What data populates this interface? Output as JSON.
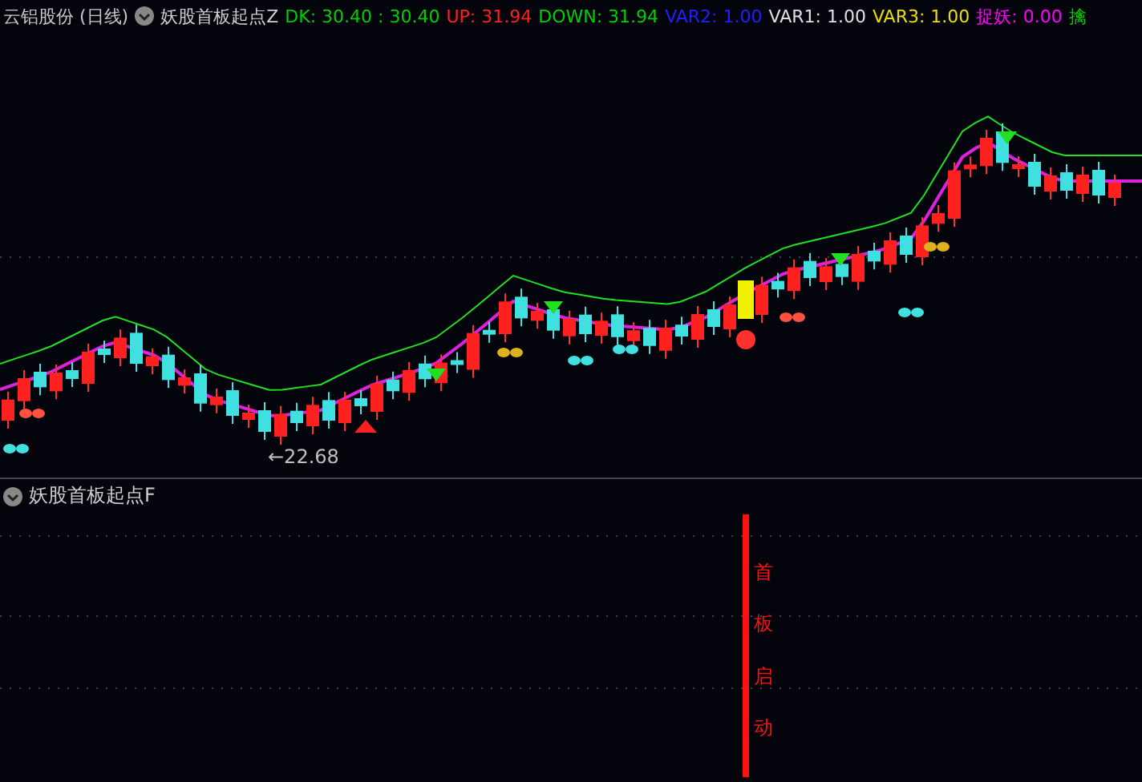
{
  "header": {
    "title": "云铝股份 (日线)",
    "indicator": "妖股首板起点Z",
    "values": [
      {
        "label": "DK:",
        "value": "30.40 : 30.40",
        "color": "#00d000"
      },
      {
        "label": "UP:",
        "value": "31.94",
        "color": "#ff2020"
      },
      {
        "label": "DOWN:",
        "value": "31.94",
        "color": "#00d000"
      },
      {
        "label": "VAR2:",
        "value": "1.00",
        "color": "#2020ff"
      },
      {
        "label": "VAR1:",
        "value": "1.00",
        "color": "#e0e0e0"
      },
      {
        "label": "VAR3:",
        "value": "1.00",
        "color": "#e8e000"
      },
      {
        "label": "捉妖:",
        "value": "0.00",
        "color": "#ff00ff"
      },
      {
        "label": "擒",
        "color": "#00d000"
      }
    ]
  },
  "main_chart": {
    "low_label": "←22.68"
  },
  "sub_panel": {
    "indicator": "妖股首板起点F",
    "signal_text": "首板启动"
  }
}
